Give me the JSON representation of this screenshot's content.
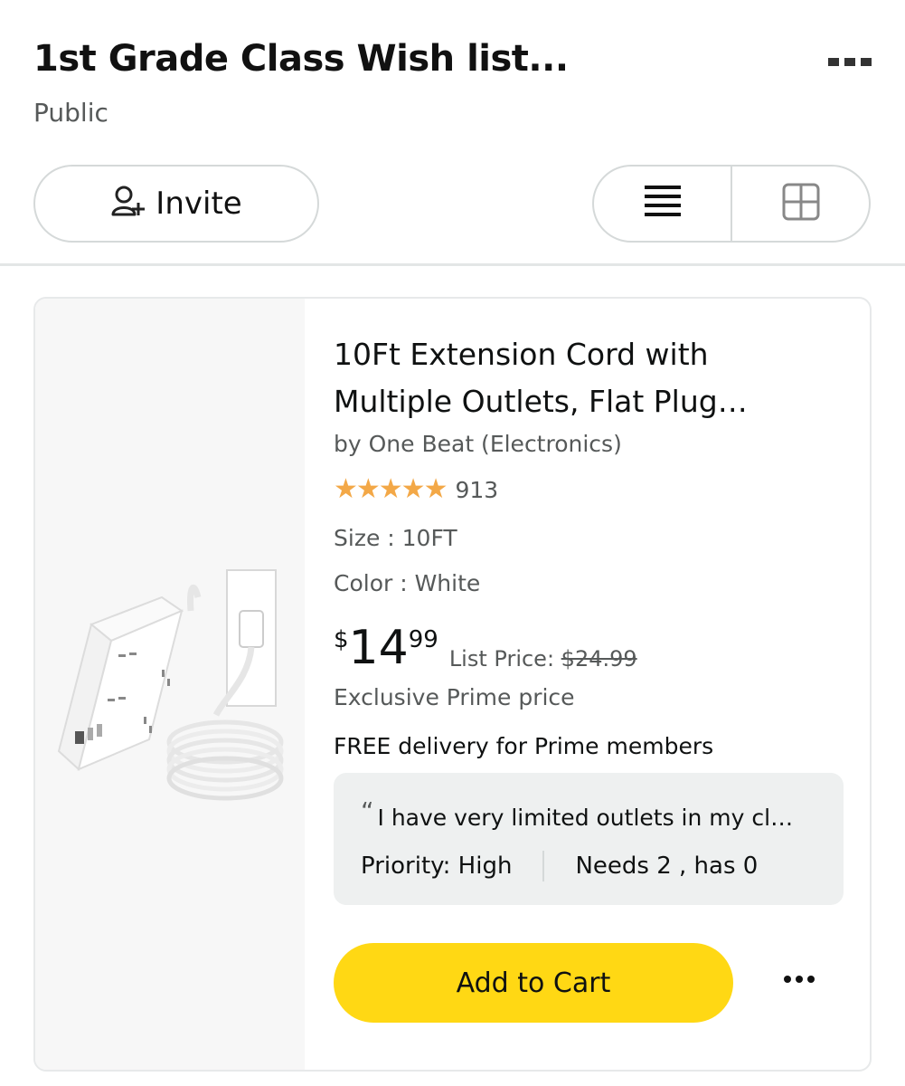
{
  "header": {
    "title": "1st Grade Class Wish list...",
    "visibility": "Public"
  },
  "toolbar": {
    "invite_label": "Invite",
    "view_modes": [
      "list",
      "grid"
    ],
    "active_view": "list"
  },
  "item": {
    "title_line1": "10Ft Extension Cord with",
    "title_line2": "Multiple Outlets, Flat Plug…",
    "byline": "by One Beat (Electronics)",
    "rating_stars": "★★★★★",
    "rating_value": 5,
    "rating_count": "913",
    "size": "Size : 10FT",
    "color": "Color : White",
    "price": {
      "currency": "$",
      "whole": "14",
      "fraction": "99"
    },
    "list_price_label": "List Price:",
    "list_price": "$24.99",
    "prime_note": "Exclusive Prime price",
    "delivery": "FREE delivery for Prime members",
    "comment": "I have very limited outlets in my cl…",
    "comment_mark": "“",
    "priority": "Priority: High",
    "needs": "Needs 2 , has 0",
    "add_to_cart": "Add to Cart"
  },
  "colors": {
    "cart_button": "#ffd814",
    "stars": "#f3a847",
    "secondary_text": "#565959"
  },
  "icons": {
    "more_header": "more-horizontal-icon",
    "invite": "add-person-icon",
    "list_view": "list-view-icon",
    "grid_view": "grid-view-icon",
    "item_more": "more-dots-icon"
  }
}
